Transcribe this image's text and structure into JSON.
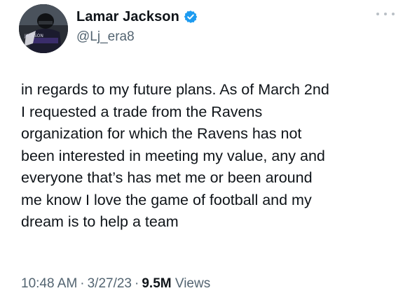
{
  "author": {
    "display_name": "Lamar Jackson",
    "handle": "@Lj_era8",
    "verified": true,
    "avatar_icon": "player-photo-avatar",
    "avatar_jersey_text": "JACKSON"
  },
  "tweet": {
    "text": "in regards to my future plans. As of March 2nd\nI requested a trade from the Ravens\norganization for which the Ravens has not\nbeen interested in meeting my value, any and\neveryone that’s has met me or been around\nme know I love the game of football and my\ndream is to help a team"
  },
  "meta": {
    "time": "10:48 AM",
    "separator": "·",
    "date": "3/27/23",
    "views_count": "9.5M",
    "views_label": "Views"
  },
  "colors": {
    "verified_badge": "#1d9bf0",
    "secondary_text": "#536471",
    "primary_text": "#0f1419"
  }
}
